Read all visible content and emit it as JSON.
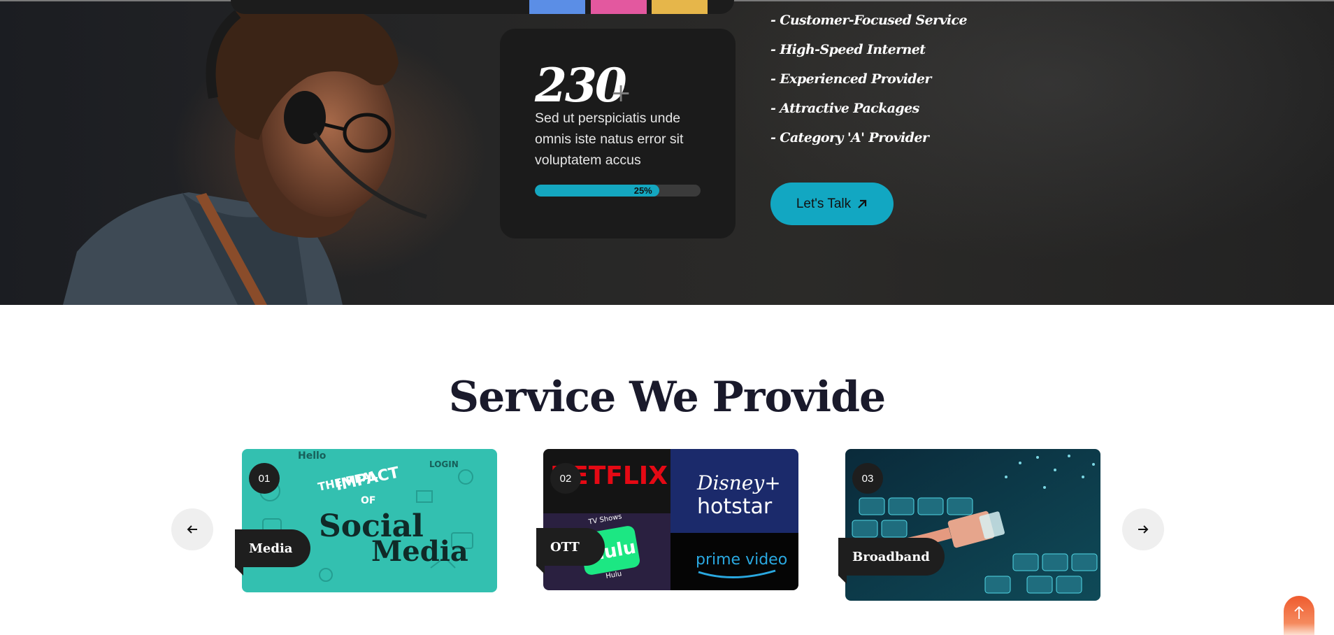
{
  "stat": {
    "number": "230",
    "plus": "+",
    "description": "Sed ut perspiciatis unde omnis iste natus error sit voluptatem accus",
    "progress_fraction": 0.25,
    "progress_label": "25%"
  },
  "features": [
    "- Customer-Focused Service",
    "- High-Speed Internet",
    "- Experienced Provider",
    "- Attractive Packages",
    "- Category 'A' Provider"
  ],
  "cta": {
    "label": "Let's Talk",
    "icon": "arrow-up-right-icon"
  },
  "colors": {
    "accent": "#12a7c2",
    "swatch_blue": "#5b8ee6",
    "swatch_pink": "#e3589f",
    "swatch_yellow": "#e6b64a",
    "scroll_top": "#ef5b2e"
  },
  "services": {
    "title": "Service We Provide",
    "cards": [
      {
        "number": "01",
        "tag": "Media",
        "image_text": [
          "Hello",
          "THE REAL",
          "IMPACT",
          "OF",
          "Social",
          "Media",
          "LOGIN"
        ]
      },
      {
        "number": "02",
        "tag": "OTT",
        "image_text": [
          "NETFLIX",
          "Disney+",
          "hotstar",
          "prime video",
          "hulu",
          "TV Shows",
          "Hulu"
        ]
      },
      {
        "number": "03",
        "tag": "Broadband",
        "image_text": []
      }
    ],
    "prev_icon": "arrow-left-icon",
    "next_icon": "arrow-right-icon"
  },
  "scroll_top_icon": "arrow-up-icon"
}
